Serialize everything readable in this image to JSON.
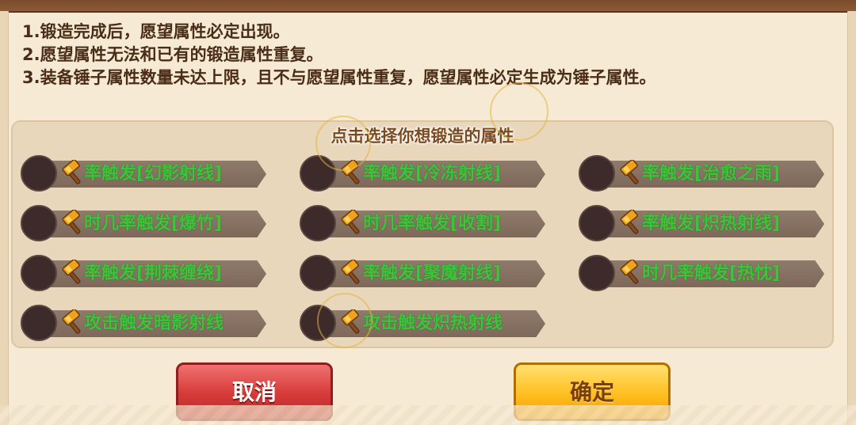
{
  "rules": [
    "1.锻造完成后，愿望属性必定出现。",
    "2.愿望属性无法和已有的锻造属性重复。",
    "3.装备锤子属性数量未达上限，且不与愿望属性重复，愿望属性必定生成为锤子属性。"
  ],
  "panel_title": "点击选择你想锻造的属性",
  "options": [
    {
      "label": "率触发[幻影射线]",
      "icon": "hammer-icon"
    },
    {
      "label": "率触发[冷冻射线]",
      "icon": "hammer-icon"
    },
    {
      "label": "率触发[治愈之雨]",
      "icon": "hammer-icon"
    },
    {
      "label": "时几率触发[爆竹]",
      "icon": "hammer-icon"
    },
    {
      "label": "时几率触发[收割]",
      "icon": "hammer-icon"
    },
    {
      "label": "率触发[炽热射线]",
      "icon": "hammer-icon"
    },
    {
      "label": "率触发[荆棘缠绕]",
      "icon": "hammer-icon"
    },
    {
      "label": "率触发[聚魔射线]",
      "icon": "hammer-icon"
    },
    {
      "label": "时几率触发[热忱]",
      "icon": "hammer-icon"
    },
    {
      "label": "攻击触发暗影射线",
      "icon": "hammer-icon"
    },
    {
      "label": "攻击触发炽热射线",
      "icon": "hammer-icon"
    }
  ],
  "buttons": {
    "cancel": "取消",
    "confirm": "确定"
  },
  "colors": {
    "option_text": "#3ec43a",
    "cancel_button": "#d43a38",
    "confirm_button": "#ffbe1f"
  }
}
